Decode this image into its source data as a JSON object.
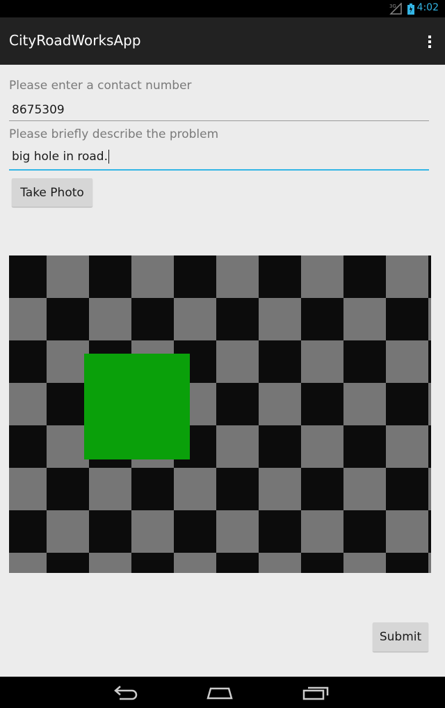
{
  "status_bar": {
    "time": "4:02",
    "network_label": "3G"
  },
  "action_bar": {
    "title": "CityRoadWorksApp",
    "overflow_icon": "overflow-menu-icon"
  },
  "form": {
    "contact_label": "Please enter a contact number",
    "contact_value": "8675309",
    "problem_label": "Please briefly describe the problem",
    "problem_value": "big hole in road.",
    "take_photo_label": "Take Photo",
    "submit_label": "Submit"
  },
  "photo": {
    "description_icon": "checkerboard-photo",
    "colors": {
      "dark": "#0c0c0c",
      "light": "#767676",
      "square": "#0aa00a"
    }
  },
  "nav_bar": {
    "back_icon": "back-icon",
    "home_icon": "home-icon",
    "recents_icon": "recents-icon"
  },
  "colors": {
    "accent": "#33b5e5",
    "action_bar": "#222222",
    "background": "#ececec"
  }
}
